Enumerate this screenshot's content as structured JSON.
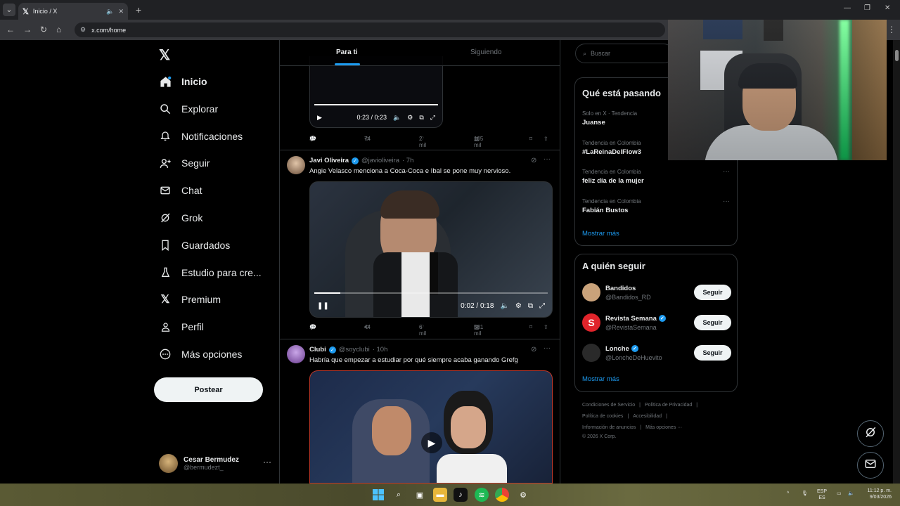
{
  "browser": {
    "tab_title": "Inicio / X",
    "url": "x.com/home"
  },
  "nav": {
    "items": [
      {
        "label": "Inicio",
        "icon": "home-icon"
      },
      {
        "label": "Explorar",
        "icon": "search-icon"
      },
      {
        "label": "Notificaciones",
        "icon": "bell-icon"
      },
      {
        "label": "Seguir",
        "icon": "person-plus-icon"
      },
      {
        "label": "Chat",
        "icon": "mail-icon"
      },
      {
        "label": "Grok",
        "icon": "grok-icon"
      },
      {
        "label": "Guardados",
        "icon": "bookmark-icon"
      },
      {
        "label": "Estudio para cre...",
        "icon": "flask-icon"
      },
      {
        "label": "Premium",
        "icon": "x-logo-icon"
      },
      {
        "label": "Perfil",
        "icon": "person-icon"
      },
      {
        "label": "Más opciones",
        "icon": "more-circle-icon"
      }
    ],
    "post_button": "Postear",
    "user": {
      "name": "Cesar Bermudez",
      "handle": "@bermudezt_"
    }
  },
  "feed": {
    "tabs": [
      "Para ti",
      "Siguiendo"
    ],
    "post0": {
      "video_time": "0:23 / 0:23",
      "video_progress": 1.0,
      "stats": {
        "replies": "35",
        "reposts": "74",
        "likes": "2 mil",
        "views": "105 mil"
      }
    },
    "post1": {
      "name": "Javi Oliveira",
      "handle": "@javioliveira",
      "time": "· 7h",
      "text": "Angie Velasco menciona a Coca-Coca e Ibal se pone muy nervioso.",
      "video_time": "0:02 / 0:18",
      "video_progress": 0.11,
      "stats": {
        "replies": "11",
        "reposts": "44",
        "likes": "6 mil",
        "views": "581 mil"
      }
    },
    "post2": {
      "name": "Clubi",
      "handle": "@soyclubi",
      "time": "· 10h",
      "text": "Habría que empezar a estudiar por qué siempre acaba ganando Grefg"
    }
  },
  "sidebar": {
    "search_placeholder": "Buscar",
    "trends_title": "Qué está pasando",
    "trends": [
      {
        "meta": "Solo en X · Tendencia",
        "name": "Juanse"
      },
      {
        "meta": "Tendencia en Colombia",
        "name": "#LaReinaDelFlow3"
      },
      {
        "meta": "Tendencia en Colombia",
        "name": "feliz día de la mujer"
      },
      {
        "meta": "Tendencia en Colombia",
        "name": "Fabián Bustos"
      }
    ],
    "trends_more": "Mostrar más",
    "follow_title": "A quién seguir",
    "follow": [
      {
        "name": "Bandidos",
        "handle": "@Bandidos_RD",
        "verified": false,
        "avatar_color": "#c9a27a",
        "initial": ""
      },
      {
        "name": "Revista Semana",
        "handle": "@RevistaSemana",
        "verified": true,
        "avatar_color": "#e0242b",
        "initial": "S"
      },
      {
        "name": "Lonche",
        "handle": "@LoncheDeHuevito",
        "verified": true,
        "avatar_color": "#2a2a2a",
        "initial": ""
      }
    ],
    "follow_button": "Seguir",
    "follow_more": "Mostrar más",
    "footer": {
      "l1": [
        "Condiciones de Servicio",
        "|",
        "Política de Privacidad",
        "|"
      ],
      "l2": [
        "Política de cookies",
        "|",
        "Accesibilidad",
        "|"
      ],
      "l3": [
        "Información de anuncios",
        "|",
        "Más opciones ···"
      ],
      "copyright": "© 2026 X Corp."
    }
  },
  "taskbar": {
    "lang_top": "ESP",
    "lang_bottom": "ES",
    "clock_time": "11:12 p. m.",
    "clock_date": "9/03/2026"
  },
  "colors": {
    "accent": "#1d9bf0",
    "border": "#2f3336",
    "muted": "#71767b"
  }
}
